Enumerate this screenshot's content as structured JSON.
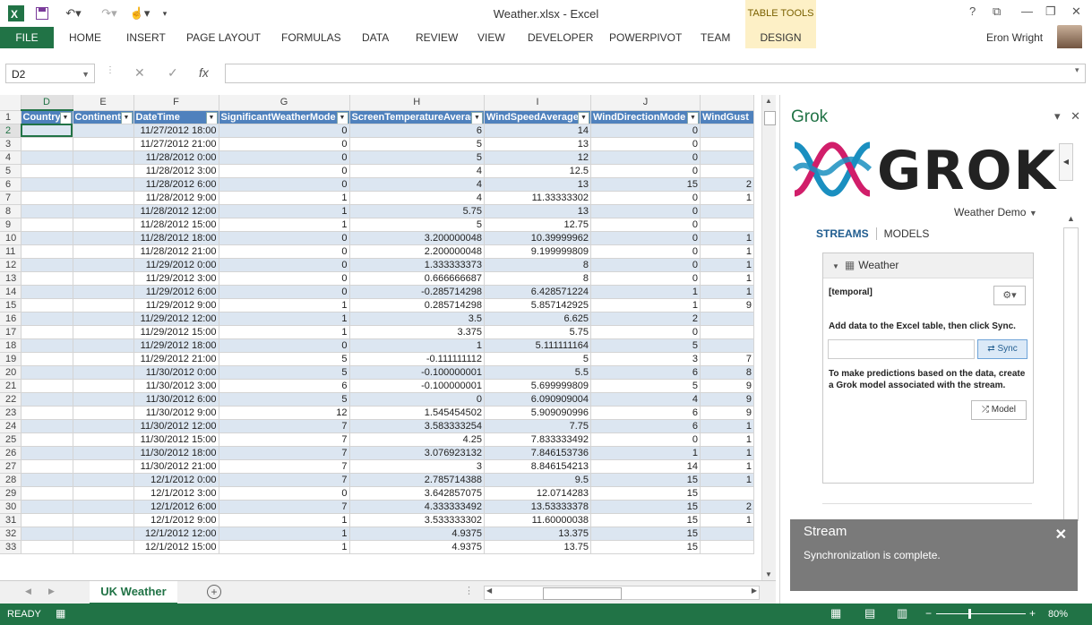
{
  "window": {
    "title": "Weather.xlsx - Excel",
    "context_group": "TABLE TOOLS",
    "help": "?",
    "minimize": "—",
    "restore": "❐",
    "close": "✕"
  },
  "ribbon": {
    "file": "FILE",
    "tabs": [
      "HOME",
      "INSERT",
      "PAGE LAYOUT",
      "FORMULAS",
      "DATA",
      "REVIEW",
      "VIEW",
      "DEVELOPER",
      "POWERPIVOT",
      "TEAM"
    ],
    "design": "DESIGN",
    "user": "Eron Wright"
  },
  "formula_bar": {
    "name_box": "D2",
    "cancel": "✕",
    "enter": "✓",
    "fx": "fx",
    "value": ""
  },
  "sheet": {
    "col_letters": [
      "",
      "D",
      "E",
      "F",
      "G",
      "H",
      "I",
      "J",
      ""
    ],
    "headers": [
      "Country",
      "Continent",
      "DateTime",
      "SignificantWeatherMode",
      "ScreenTemperatureAverage",
      "WindSpeedAverage",
      "WindDirectionMode",
      "WindGust"
    ],
    "rows": [
      [
        "2",
        "",
        "",
        "11/27/2012 18:00",
        "0",
        "6",
        "14",
        "0",
        ""
      ],
      [
        "3",
        "",
        "",
        "11/27/2012 21:00",
        "0",
        "5",
        "13",
        "0",
        ""
      ],
      [
        "4",
        "",
        "",
        "11/28/2012 0:00",
        "0",
        "5",
        "12",
        "0",
        ""
      ],
      [
        "5",
        "",
        "",
        "11/28/2012 3:00",
        "0",
        "4",
        "12.5",
        "0",
        ""
      ],
      [
        "6",
        "",
        "",
        "11/28/2012 6:00",
        "0",
        "4",
        "13",
        "15",
        "2"
      ],
      [
        "7",
        "",
        "",
        "11/28/2012 9:00",
        "1",
        "4",
        "11.33333302",
        "0",
        "1"
      ],
      [
        "8",
        "",
        "",
        "11/28/2012 12:00",
        "1",
        "5.75",
        "13",
        "0",
        ""
      ],
      [
        "9",
        "",
        "",
        "11/28/2012 15:00",
        "1",
        "5",
        "12.75",
        "0",
        ""
      ],
      [
        "10",
        "",
        "",
        "11/28/2012 18:00",
        "0",
        "3.200000048",
        "10.39999962",
        "0",
        "1"
      ],
      [
        "11",
        "",
        "",
        "11/28/2012 21:00",
        "0",
        "2.200000048",
        "9.199999809",
        "0",
        "1"
      ],
      [
        "12",
        "",
        "",
        "11/29/2012 0:00",
        "0",
        "1.333333373",
        "8",
        "0",
        "1"
      ],
      [
        "13",
        "",
        "",
        "11/29/2012 3:00",
        "0",
        "0.666666687",
        "8",
        "0",
        "1"
      ],
      [
        "14",
        "",
        "",
        "11/29/2012 6:00",
        "0",
        "-0.285714298",
        "6.428571224",
        "1",
        "1"
      ],
      [
        "15",
        "",
        "",
        "11/29/2012 9:00",
        "1",
        "0.285714298",
        "5.857142925",
        "1",
        "9"
      ],
      [
        "16",
        "",
        "",
        "11/29/2012 12:00",
        "1",
        "3.5",
        "6.625",
        "2",
        ""
      ],
      [
        "17",
        "",
        "",
        "11/29/2012 15:00",
        "1",
        "3.375",
        "5.75",
        "0",
        ""
      ],
      [
        "18",
        "",
        "",
        "11/29/2012 18:00",
        "0",
        "1",
        "5.111111164",
        "5",
        ""
      ],
      [
        "19",
        "",
        "",
        "11/29/2012 21:00",
        "5",
        "-0.111111112",
        "5",
        "3",
        "7"
      ],
      [
        "20",
        "",
        "",
        "11/30/2012 0:00",
        "5",
        "-0.100000001",
        "5.5",
        "6",
        "8"
      ],
      [
        "21",
        "",
        "",
        "11/30/2012 3:00",
        "6",
        "-0.100000001",
        "5.699999809",
        "5",
        "9"
      ],
      [
        "22",
        "",
        "",
        "11/30/2012 6:00",
        "5",
        "0",
        "6.090909004",
        "4",
        "9"
      ],
      [
        "23",
        "",
        "",
        "11/30/2012 9:00",
        "12",
        "1.545454502",
        "5.909090996",
        "6",
        "9"
      ],
      [
        "24",
        "",
        "",
        "11/30/2012 12:00",
        "7",
        "3.583333254",
        "7.75",
        "6",
        "1"
      ],
      [
        "25",
        "",
        "",
        "11/30/2012 15:00",
        "7",
        "4.25",
        "7.833333492",
        "0",
        "1"
      ],
      [
        "26",
        "",
        "",
        "11/30/2012 18:00",
        "7",
        "3.076923132",
        "7.846153736",
        "1",
        "1"
      ],
      [
        "27",
        "",
        "",
        "11/30/2012 21:00",
        "7",
        "3",
        "8.846154213",
        "14",
        "1"
      ],
      [
        "28",
        "",
        "",
        "12/1/2012 0:00",
        "7",
        "2.785714388",
        "9.5",
        "15",
        "1"
      ],
      [
        "29",
        "",
        "",
        "12/1/2012 3:00",
        "0",
        "3.642857075",
        "12.0714283",
        "15",
        ""
      ],
      [
        "30",
        "",
        "",
        "12/1/2012 6:00",
        "7",
        "4.333333492",
        "13.53333378",
        "15",
        "2"
      ],
      [
        "31",
        "",
        "",
        "12/1/2012 9:00",
        "1",
        "3.533333302",
        "11.60000038",
        "15",
        "1"
      ],
      [
        "32",
        "",
        "",
        "12/1/2012 12:00",
        "1",
        "4.9375",
        "13.375",
        "15",
        ""
      ],
      [
        "33",
        "",
        "",
        "12/1/2012 15:00",
        "1",
        "4.9375",
        "13.75",
        "15",
        ""
      ]
    ],
    "tab_name": "UK Weather"
  },
  "status": {
    "ready": "READY",
    "zoom": "80%"
  },
  "pane": {
    "title": "Grok",
    "logo_text": "GROK",
    "demo": "Weather Demo",
    "tabs": {
      "streams": "STREAMS",
      "models": "MODELS"
    },
    "card": {
      "title": "Weather",
      "temporal": "[temporal]",
      "instructions": "Add data to the Excel table, then click Sync.",
      "sync": "Sync",
      "prediction_hint": "To make predictions based on the data, create a Grok model associated with the stream.",
      "model": "Model"
    }
  },
  "toast": {
    "title": "Stream",
    "message": "Synchronization is complete.",
    "close": "✕"
  },
  "colors": {
    "excel_green": "#217346",
    "table_header": "#4f81bd",
    "band": "#dce6f1",
    "toast": "#7a7a7a"
  }
}
